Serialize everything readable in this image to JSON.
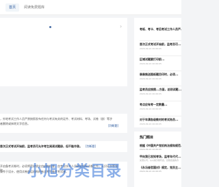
{
  "nav": {
    "home_label": "首页",
    "other_label": "阅读免费题库"
  },
  "articles": [
    {
      "line1": "，外地考试工作人员严禁按照发布任何与考试有关的证件、考试材料、考场、试卷（册）等涉",
      "line2": "者删除或抹除文字信息。",
      "more": "[判断题]"
    },
    {
      "line1": "首次正式考试开始前，监考员可允许考生阅读试题册，但不能作答。",
      "more": "[判断题]"
    },
    {
      "line1": "开启备考试卷时，必须将密封袋交由机构检查，由专业技术人员取走所有试卷工作，认识证书等领取，",
      "line2": "录作于设计，使用试卷前运机构的有志考生参考考试者，"
    }
  ],
  "sidebar": [
    {
      "title": "考纸、考卡、考后考试工作人员严...",
      "date": ""
    },
    {
      "title": "首次正式考试开始前，监考员可...",
      "date": "2020-09-22 20:06:05"
    },
    {
      "title": "区域试题要打印前...",
      "date": "2020-09-22 20:06:05"
    },
    {
      "title": "装装推送图纸题目印时，必须...",
      "date": "2020-09-22 20:06:05"
    },
    {
      "title": "监考员应按照...方面，总则试题...",
      "date": "2020-09-22 20:06:05"
    },
    {
      "title": "考点应有考一定数量...",
      "date": "2020-09-22 20:06:05"
    },
    {
      "title": "对于年满各级教材的考试务员...",
      "date": "2020-09-22 20:06:05"
    }
  ],
  "hot": {
    "heading": "热门题目",
    "items": [
      {
        "title": "根据《中国共产党机构法规和规范...",
        "sub": "2020-09-22 20:06:05"
      },
      {
        "title": "甲向我已发知考场，监考年代代...",
        "sub": "交流认可，从以来分别代表，比较合适的方"
      },
      {
        "title": "《永冯奋哲国对》规定，党员主...",
        "sub": "2020-09-22 20:06:05"
      }
    ]
  },
  "watermark": "小旭分类目录"
}
